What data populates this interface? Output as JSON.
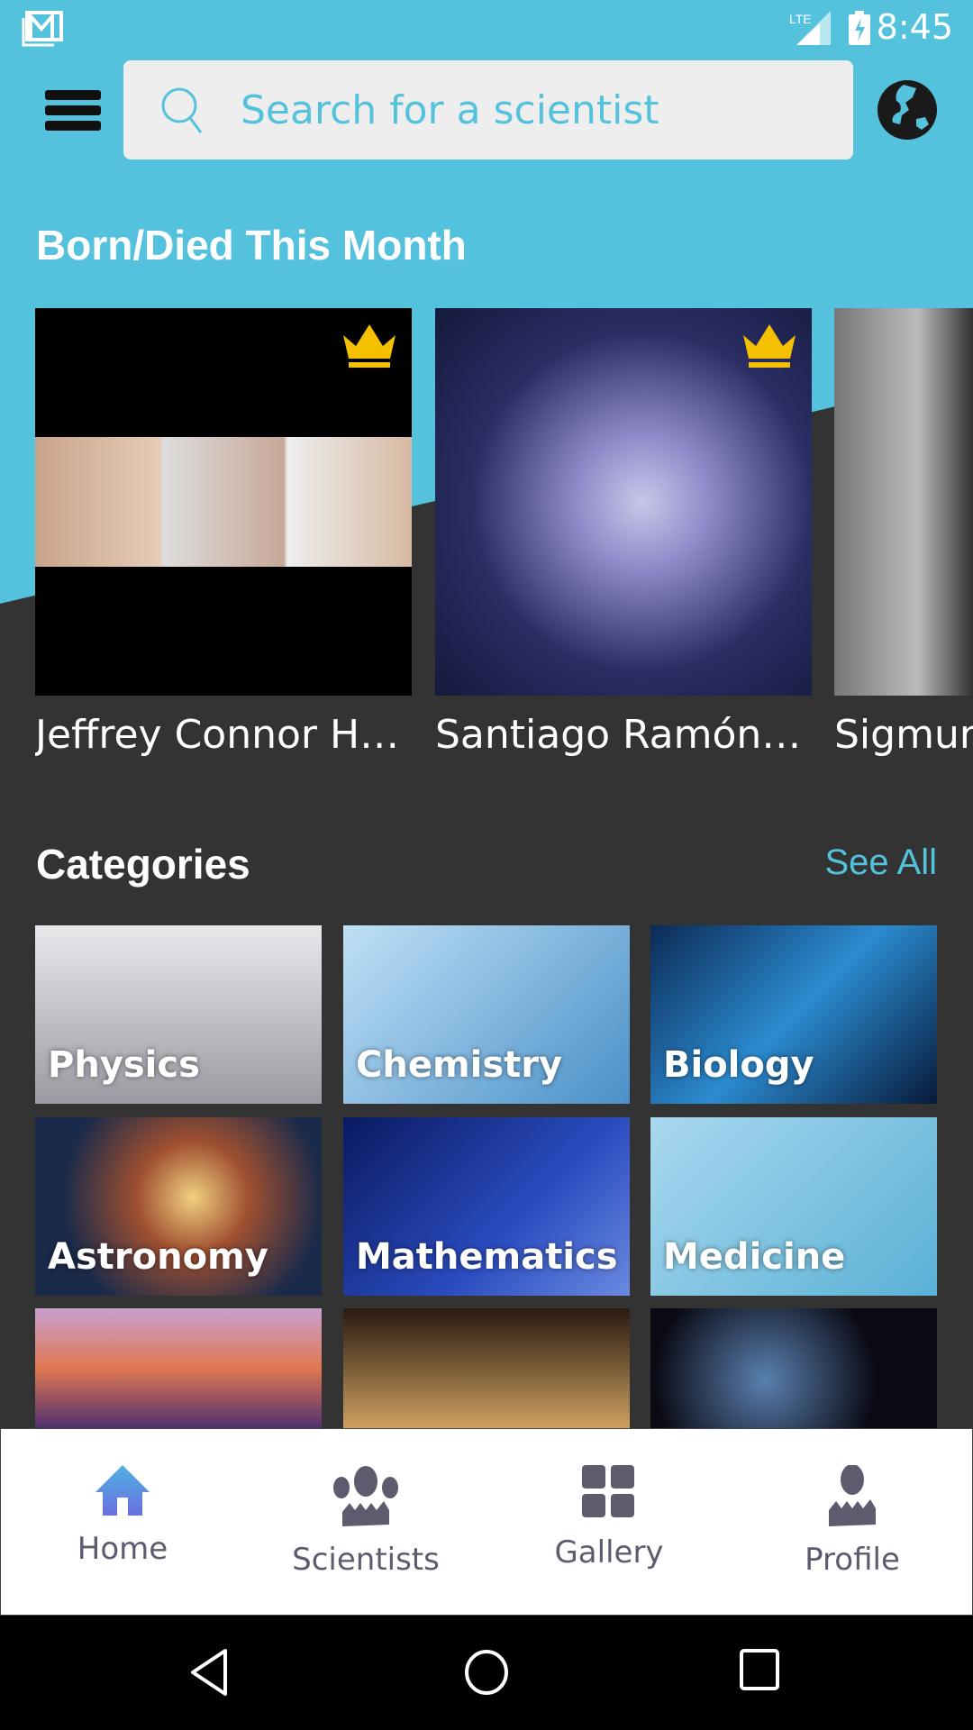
{
  "status_bar": {
    "time": "8:45",
    "network": "LTE",
    "icons": [
      "gmail-icon",
      "signal-icon",
      "battery-charging-icon"
    ]
  },
  "header": {
    "search_placeholder": "Search for a scientist",
    "menu_icon": "hamburger-icon",
    "globe_icon": "globe-icon"
  },
  "born_died": {
    "title": "Born/Died This Month",
    "cards": [
      {
        "name": "Jeffrey Connor H…",
        "premium": true
      },
      {
        "name": "Santiago Ramón…",
        "premium": true
      },
      {
        "name": "Sigmund",
        "premium": false
      }
    ]
  },
  "categories": {
    "title": "Categories",
    "see_all": "See All",
    "items": [
      {
        "label": "Physics"
      },
      {
        "label": "Chemistry"
      },
      {
        "label": "Biology"
      },
      {
        "label": "Astronomy"
      },
      {
        "label": "Mathematics"
      },
      {
        "label": "Medicine"
      },
      {
        "label": ""
      },
      {
        "label": ""
      },
      {
        "label": ""
      }
    ]
  },
  "bottom_nav": {
    "items": [
      {
        "label": "Home",
        "active": true
      },
      {
        "label": "Scientists"
      },
      {
        "label": "Gallery"
      },
      {
        "label": "Profile"
      }
    ]
  },
  "colors": {
    "accent": "#54c2dc",
    "background": "#333333",
    "nav_text": "#5e5b6e",
    "crown": "#f5c000"
  }
}
